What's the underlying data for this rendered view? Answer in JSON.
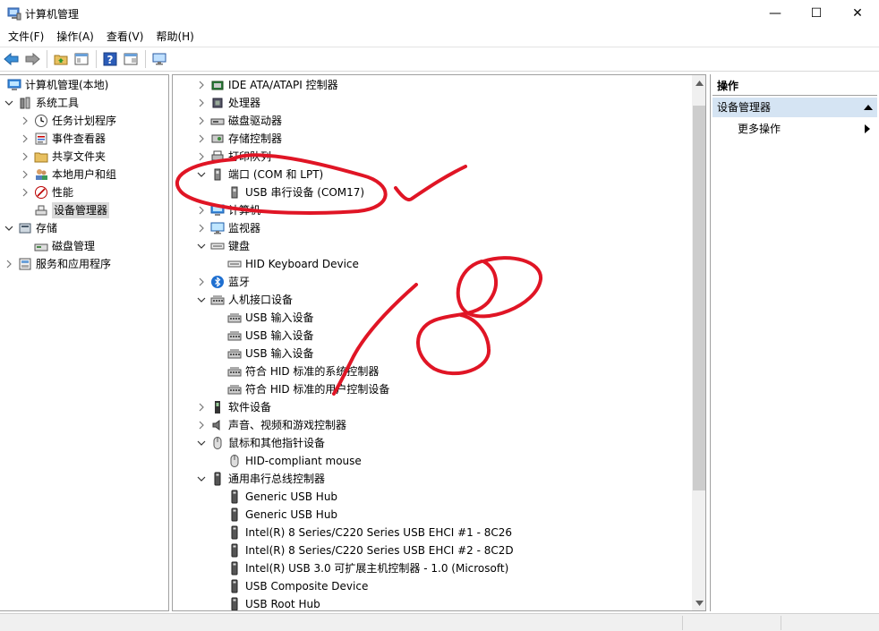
{
  "window": {
    "title": "计算机管理",
    "minimize_glyph": "—",
    "maximize_glyph": "☐",
    "close_glyph": "✕"
  },
  "menu": [
    "文件(F)",
    "操作(A)",
    "查看(V)",
    "帮助(H)"
  ],
  "toolbar_icons": [
    "back-arrow-icon",
    "forward-arrow-icon",
    "up-folder-icon",
    "show-hide-tree-icon",
    "help-icon",
    "properties-icon",
    "monitor-icon"
  ],
  "left_tree": [
    {
      "label": "计算机管理(本地)",
      "level": 0,
      "expander": "",
      "icon": "computer-icon"
    },
    {
      "label": "系统工具",
      "level": 0,
      "expander": "down",
      "icon": "tools-icon"
    },
    {
      "label": "任务计划程序",
      "level": 1,
      "expander": "right",
      "icon": "clock-icon"
    },
    {
      "label": "事件查看器",
      "level": 1,
      "expander": "right",
      "icon": "event-icon"
    },
    {
      "label": "共享文件夹",
      "level": 1,
      "expander": "right",
      "icon": "folder-icon"
    },
    {
      "label": "本地用户和组",
      "level": 1,
      "expander": "right",
      "icon": "users-icon"
    },
    {
      "label": "性能",
      "level": 1,
      "expander": "right",
      "icon": "performance-icon"
    },
    {
      "label": "设备管理器",
      "level": 1,
      "expander": "",
      "icon": "device-manager-icon",
      "selected": true
    },
    {
      "label": "存储",
      "level": 0,
      "expander": "down",
      "icon": "storage-icon"
    },
    {
      "label": "磁盘管理",
      "level": 1,
      "expander": "",
      "icon": "disk-icon"
    },
    {
      "label": "服务和应用程序",
      "level": 0,
      "expander": "right",
      "icon": "services-icon"
    }
  ],
  "device_tree": [
    {
      "label": "IDE ATA/ATAPI 控制器",
      "level": 0,
      "expander": "right",
      "icon": "ide-controller-icon"
    },
    {
      "label": "处理器",
      "level": 0,
      "expander": "right",
      "icon": "processor-icon"
    },
    {
      "label": "磁盘驱动器",
      "level": 0,
      "expander": "right",
      "icon": "disk-drive-icon"
    },
    {
      "label": "存储控制器",
      "level": 0,
      "expander": "right",
      "icon": "storage-controller-icon"
    },
    {
      "label": "打印队列",
      "level": 0,
      "expander": "right",
      "icon": "printer-icon"
    },
    {
      "label": "端口 (COM 和 LPT)",
      "level": 0,
      "expander": "down",
      "icon": "port-icon"
    },
    {
      "label": "USB 串行设备 (COM17)",
      "level": 1,
      "expander": "",
      "icon": "port-icon"
    },
    {
      "label": "计算机",
      "level": 0,
      "expander": "right",
      "icon": "computer-icon"
    },
    {
      "label": "监视器",
      "level": 0,
      "expander": "right",
      "icon": "monitor-icon"
    },
    {
      "label": "键盘",
      "level": 0,
      "expander": "down",
      "icon": "keyboard-icon"
    },
    {
      "label": "HID Keyboard Device",
      "level": 1,
      "expander": "",
      "icon": "keyboard-icon"
    },
    {
      "label": "蓝牙",
      "level": 0,
      "expander": "right",
      "icon": "bluetooth-icon"
    },
    {
      "label": "人机接口设备",
      "level": 0,
      "expander": "down",
      "icon": "hid-icon"
    },
    {
      "label": "USB 输入设备",
      "level": 1,
      "expander": "",
      "icon": "hid-icon"
    },
    {
      "label": "USB 输入设备",
      "level": 1,
      "expander": "",
      "icon": "hid-icon"
    },
    {
      "label": "USB 输入设备",
      "level": 1,
      "expander": "",
      "icon": "hid-icon"
    },
    {
      "label": "符合 HID 标准的系统控制器",
      "level": 1,
      "expander": "",
      "icon": "hid-icon"
    },
    {
      "label": "符合 HID 标准的用户控制设备",
      "level": 1,
      "expander": "",
      "icon": "hid-icon"
    },
    {
      "label": "软件设备",
      "level": 0,
      "expander": "right",
      "icon": "software-device-icon"
    },
    {
      "label": "声音、视频和游戏控制器",
      "level": 0,
      "expander": "right",
      "icon": "audio-icon"
    },
    {
      "label": "鼠标和其他指针设备",
      "level": 0,
      "expander": "down",
      "icon": "mouse-icon"
    },
    {
      "label": "HID-compliant mouse",
      "level": 1,
      "expander": "",
      "icon": "mouse-icon"
    },
    {
      "label": "通用串行总线控制器",
      "level": 0,
      "expander": "down",
      "icon": "usb-icon"
    },
    {
      "label": "Generic USB Hub",
      "level": 1,
      "expander": "",
      "icon": "usb-icon"
    },
    {
      "label": "Generic USB Hub",
      "level": 1,
      "expander": "",
      "icon": "usb-icon"
    },
    {
      "label": "Intel(R) 8 Series/C220 Series USB EHCI #1 - 8C26",
      "level": 1,
      "expander": "",
      "icon": "usb-icon"
    },
    {
      "label": "Intel(R) 8 Series/C220 Series USB EHCI #2 - 8C2D",
      "level": 1,
      "expander": "",
      "icon": "usb-icon"
    },
    {
      "label": "Intel(R) USB 3.0 可扩展主机控制器 - 1.0 (Microsoft)",
      "level": 1,
      "expander": "",
      "icon": "usb-icon"
    },
    {
      "label": "USB Composite Device",
      "level": 1,
      "expander": "",
      "icon": "usb-icon"
    },
    {
      "label": "USB Root Hub",
      "level": 1,
      "expander": "",
      "icon": "usb-icon"
    }
  ],
  "actions": {
    "header": "操作",
    "section": "设备管理器",
    "more": "更多操作"
  },
  "colors": {
    "annotation": "#e01525",
    "selection": "#d9d9d9",
    "action_section": "#d5e4f3"
  }
}
